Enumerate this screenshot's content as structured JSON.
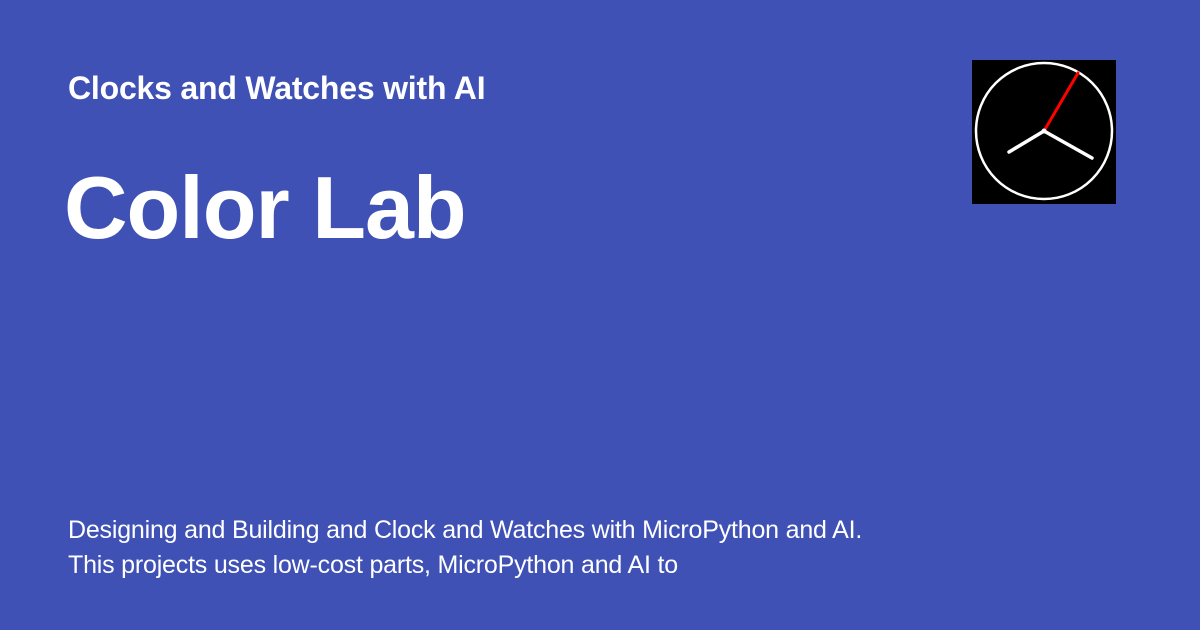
{
  "card": {
    "site_name": "Clocks and Watches with AI",
    "page_title": "Color Lab",
    "description": "Designing and Building and Clock and Watches with MicroPython and AI.  This projects uses low-cost parts, MicroPython and AI to",
    "logo_icon": "analog-clock-icon",
    "colors": {
      "background": "#3f51b5",
      "text": "#ffffff",
      "logo_background": "#000000",
      "logo_hands": "#ffffff",
      "logo_second_hand": "#ff0000"
    }
  }
}
